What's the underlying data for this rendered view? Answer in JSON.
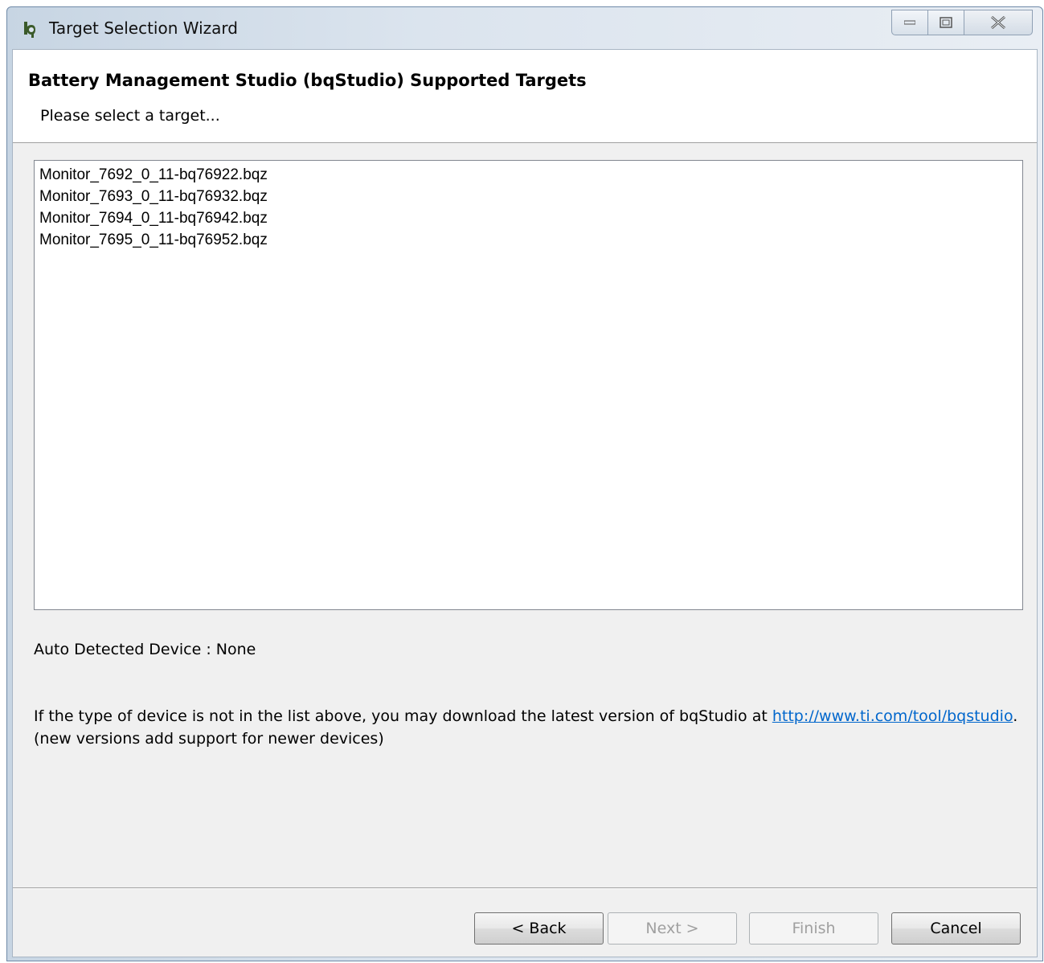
{
  "window": {
    "title": "Target Selection Wizard"
  },
  "header": {
    "title": "Battery Management Studio (bqStudio) Supported Targets",
    "subtitle": "Please select a target..."
  },
  "targets": [
    "Monitor_7692_0_11-bq76922.bqz",
    "Monitor_7693_0_11-bq76932.bqz",
    "Monitor_7694_0_11-bq76942.bqz",
    "Monitor_7695_0_11-bq76952.bqz"
  ],
  "auto_detected": "Auto Detected Device : None",
  "info": {
    "text_before_link": "If the type of device is not in the list above, you may download the latest version of bqStudio at ",
    "link": "http://www.ti.com/tool/bqstudio",
    "text_after_link": ".",
    "line2": "(new versions add support for newer devices)"
  },
  "buttons": {
    "back": "< Back",
    "next": "Next >",
    "finish": "Finish",
    "cancel": "Cancel"
  },
  "colors": {
    "link": "#0066cc",
    "disabled_text": "#a0a0a0"
  }
}
